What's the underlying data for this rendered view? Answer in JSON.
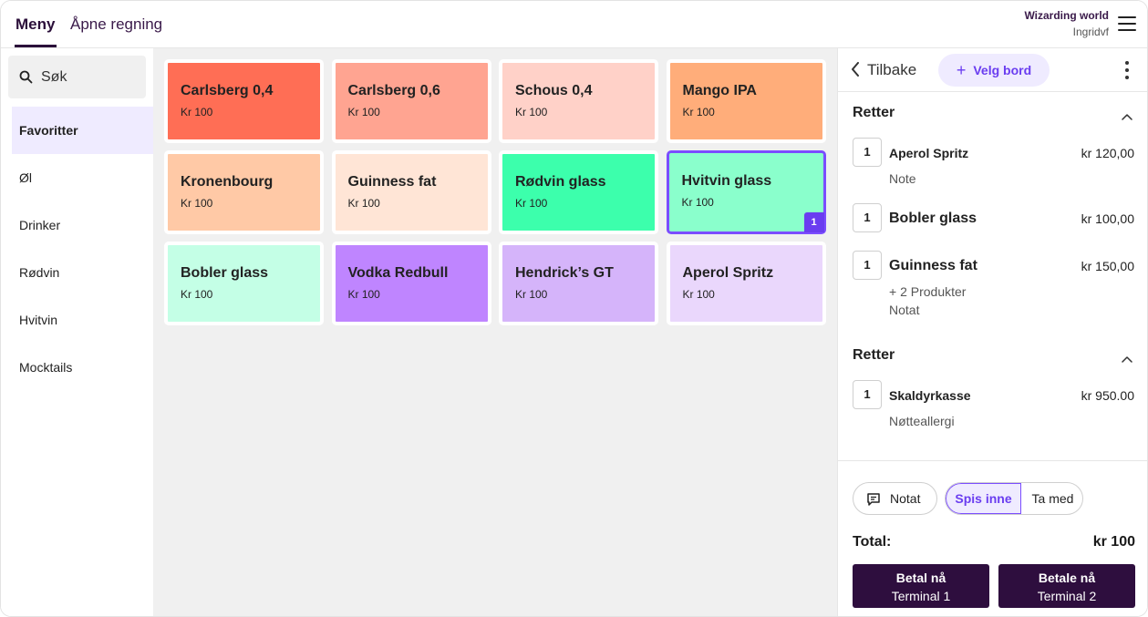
{
  "header": {
    "tabs": [
      {
        "label": "Meny",
        "active": true
      },
      {
        "label": "Åpne regning",
        "active": false
      }
    ],
    "org": "Wizarding world",
    "user": "Ingridvf",
    "menu_icon": "hamburger-icon"
  },
  "sidebar": {
    "search_placeholder": "Søk",
    "categories": [
      {
        "label": "Favoritter",
        "active": true
      },
      {
        "label": "Øl"
      },
      {
        "label": "Drinker"
      },
      {
        "label": "Rødvin"
      },
      {
        "label": "Hvitvin"
      },
      {
        "label": "Mocktails"
      }
    ]
  },
  "products": [
    {
      "name": "Carlsberg 0,4",
      "price": "Kr 100",
      "color": "#ff6e55"
    },
    {
      "name": "Carlsberg 0,6",
      "price": "Kr 100",
      "color": "#ffa491"
    },
    {
      "name": "Schous 0,4",
      "price": "Kr 100",
      "color": "#ffd1c8"
    },
    {
      "name": "Mango IPA",
      "price": "Kr 100",
      "color": "#ffad7a"
    },
    {
      "name": "Kronenbourg",
      "price": "Kr 100",
      "color": "#ffc9a6"
    },
    {
      "name": "Guinness fat",
      "price": "Kr 100",
      "color": "#ffe5d6"
    },
    {
      "name": "Rødvin glass",
      "price": "Kr 100",
      "color": "#3cffac"
    },
    {
      "name": "Hvitvin glass",
      "price": "Kr 100",
      "color": "#8affcc",
      "selected": true,
      "badge": "1"
    },
    {
      "name": "Bobler glass",
      "price": "Kr 100",
      "color": "#c4ffe6"
    },
    {
      "name": "Vodka Redbull",
      "price": "Kr 100",
      "color": "#bf85ff"
    },
    {
      "name": "Hendrick’s GT",
      "price": "Kr 100",
      "color": "#d5b4fa"
    },
    {
      "name": "Aperol Spritz",
      "price": "Kr 100",
      "color": "#ead7fc"
    }
  ],
  "order": {
    "back_label": "Tilbake",
    "table_button": "Velg bord",
    "sections": [
      {
        "title": "Retter",
        "items": [
          {
            "qty": "1",
            "name": "Aperol Spritz",
            "price": "kr 120,00",
            "subs": [
              "Note"
            ]
          },
          {
            "qty": "1",
            "name": "Bobler glass",
            "price": "kr 100,00",
            "subs": []
          },
          {
            "qty": "1",
            "name": "Guinness fat",
            "price": "kr 150,00",
            "subs": [
              "+ 2 Produkter",
              "Notat"
            ]
          }
        ]
      },
      {
        "title": "Retter",
        "items": [
          {
            "qty": "1",
            "name": "Skaldyrkasse",
            "price": "kr 950.00",
            "subs": [
              "Nøtteallergi"
            ]
          }
        ]
      }
    ],
    "note_button": "Notat",
    "dine_in": "Spis inne",
    "take_away": "Ta med",
    "total_label": "Total:",
    "total_value": "kr 100",
    "pay_buttons": [
      {
        "line1": "Betal nå",
        "line2": "Terminal 1"
      },
      {
        "line1": "Betale nå",
        "line2": "Terminal 2"
      }
    ]
  }
}
